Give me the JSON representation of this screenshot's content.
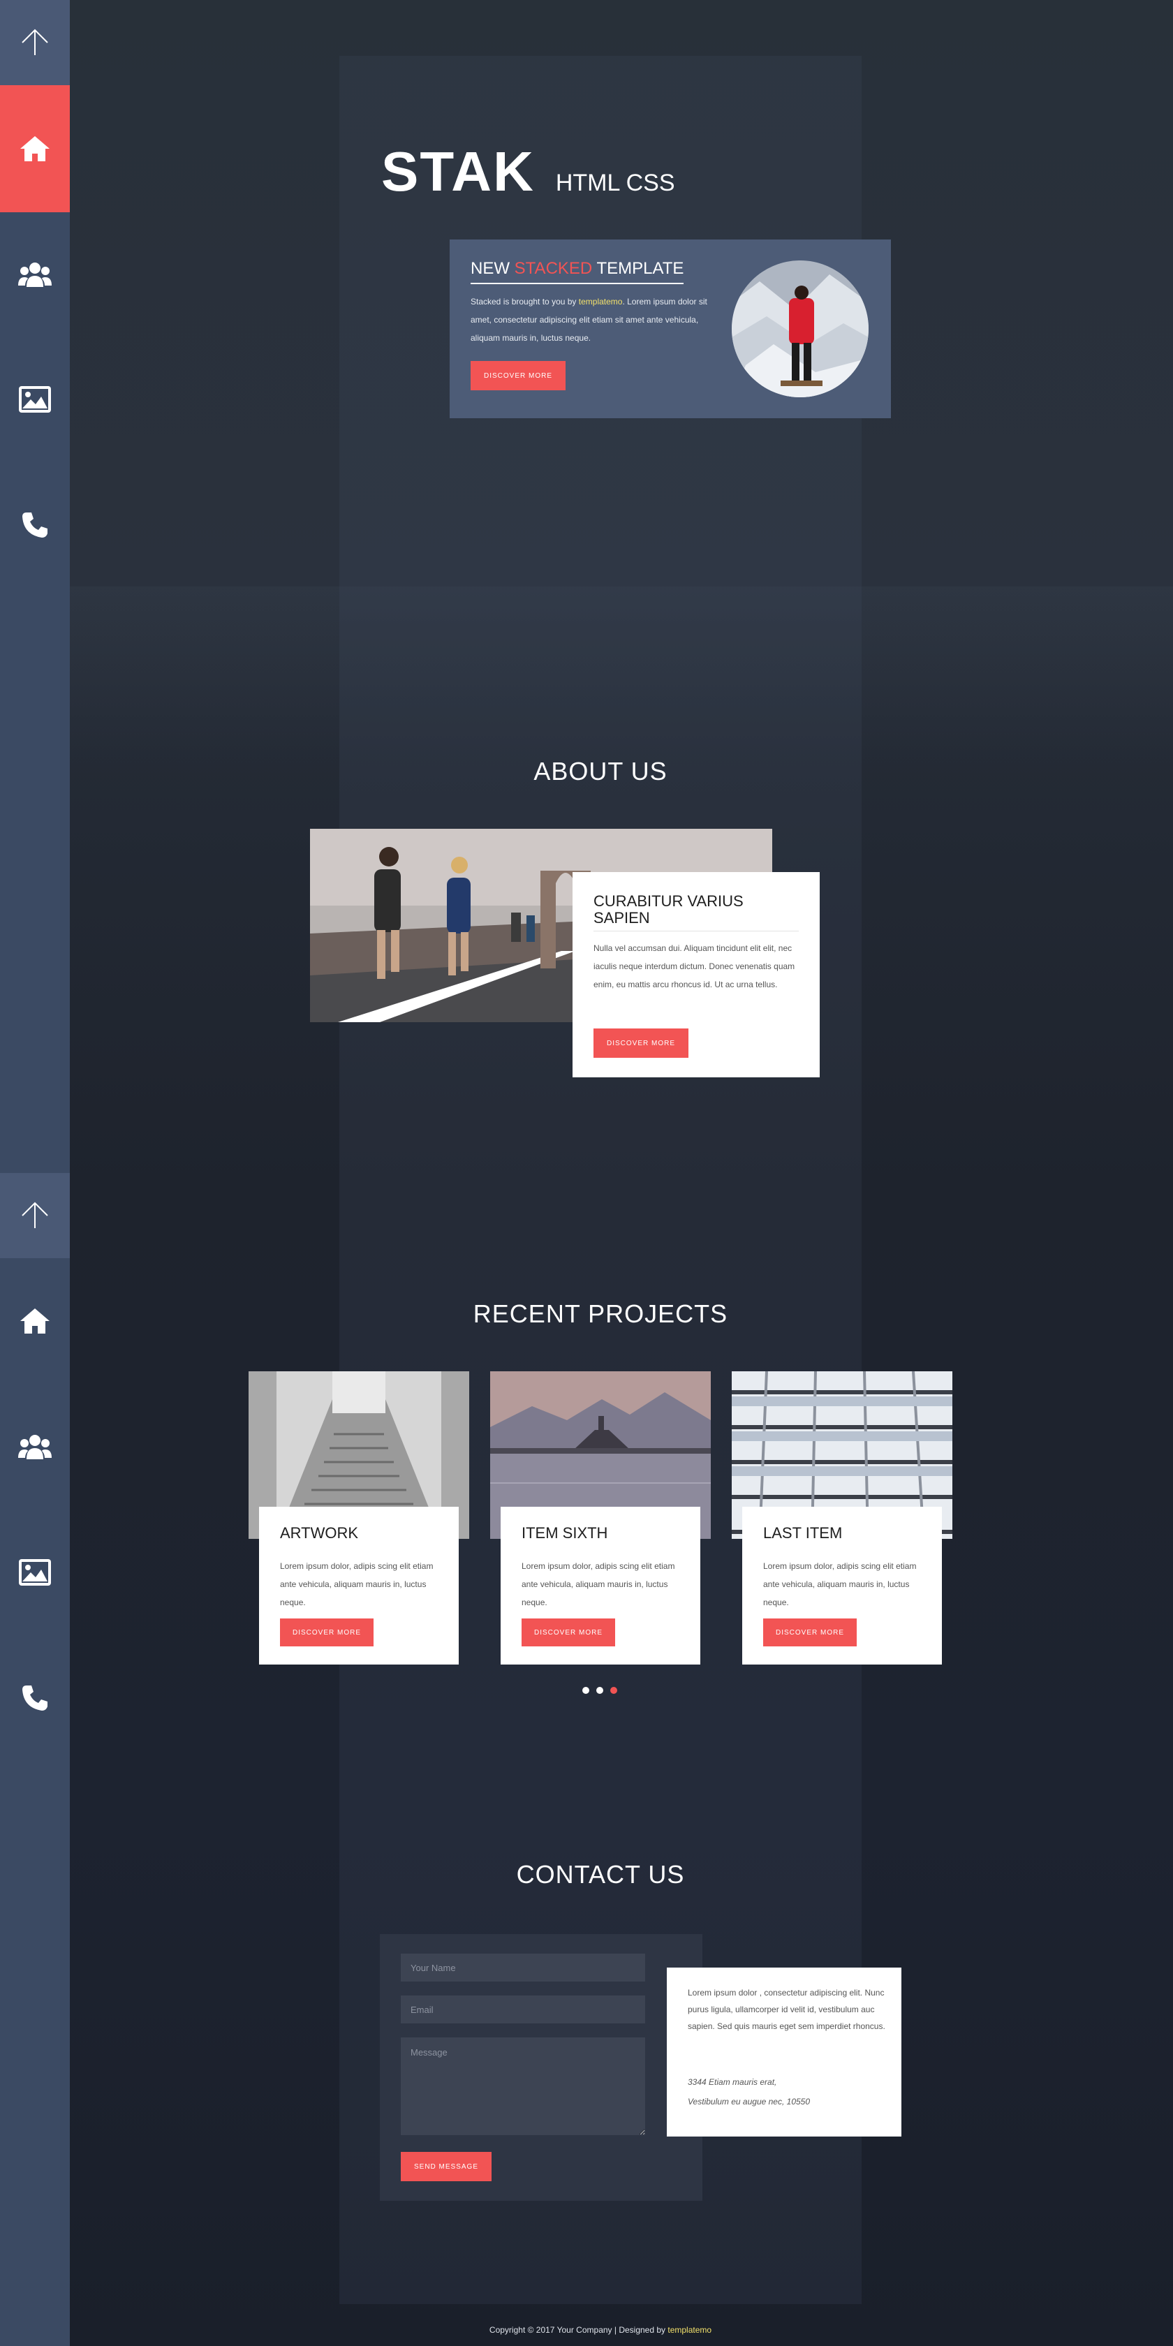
{
  "sidebar": {
    "groups": [
      {
        "icons": [
          "arrow-up-icon",
          "home-icon",
          "users-icon",
          "image-icon",
          "phone-icon"
        ],
        "active": "home-icon"
      },
      {
        "icons": [
          "arrow-up-icon",
          "home-icon",
          "users-icon",
          "image-icon",
          "phone-icon"
        ],
        "active": ""
      }
    ],
    "accent": "#f25454"
  },
  "hero": {
    "logo": "STAK",
    "logo_sub": "HTML CSS",
    "card": {
      "heading_pre": "NEW ",
      "heading_accent": "STACKED",
      "heading_post": " TEMPLATE",
      "text_pre": "Stacked is brought to you by ",
      "text_link": "templatemo",
      "text_post": ". Lorem ipsum dolor sit amet, consectetur adipiscing elit etiam sit amet ante vehicula, aliquam mauris in, luctus neque.",
      "button": "DISCOVER MORE"
    }
  },
  "about": {
    "title": "ABOUT US",
    "card": {
      "heading": "CURABITUR VARIUS SAPIEN",
      "text": "Nulla vel accumsan dui. Aliquam tincidunt elit elit, nec iaculis neque interdum dictum. Donec venenatis quam enim, eu mattis arcu rhoncus id. Ut ac urna tellus.",
      "button": "DISCOVER MORE"
    }
  },
  "projects": {
    "title": "RECENT PROJECTS",
    "items": [
      {
        "heading": "ARTWORK",
        "text": "Lorem ipsum dolor, adipis scing elit etiam ante vehicula, aliquam mauris in, luctus neque.",
        "button": "DISCOVER MORE"
      },
      {
        "heading": "ITEM SIXTH",
        "text": "Lorem ipsum dolor, adipis scing elit etiam ante vehicula, aliquam mauris in, luctus neque.",
        "button": "DISCOVER MORE"
      },
      {
        "heading": "LAST ITEM",
        "text": "Lorem ipsum dolor, adipis scing elit etiam ante vehicula, aliquam mauris in, luctus neque.",
        "button": "DISCOVER MORE"
      }
    ],
    "active_slide": 3
  },
  "contact": {
    "title": "CONTACT US",
    "name_placeholder": "Your Name",
    "email_placeholder": "Email",
    "message_placeholder": "Message",
    "submit": "SEND MESSAGE",
    "info_text": "Lorem ipsum dolor , consectetur adipiscing elit. Nunc purus ligula, ullamcorper id velit id, vestibulum auc sapien. Sed quis mauris eget sem imperdiet rhoncus.",
    "address_line1": "3344 Etiam mauris erat,",
    "address_line2": "Vestibulum eu augue nec, 10550"
  },
  "footer": {
    "text": "Copyright © 2017 Your Company | Designed by ",
    "link": "templatemo"
  }
}
